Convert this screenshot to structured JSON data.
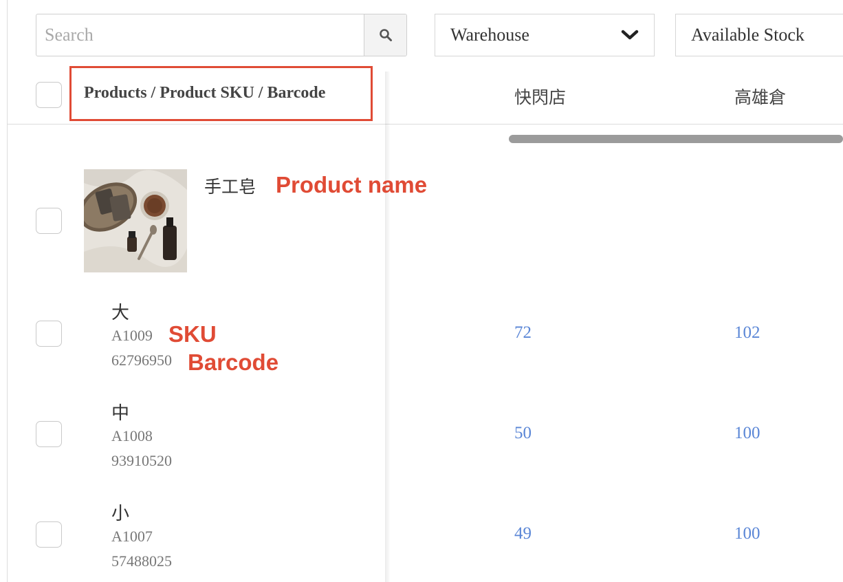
{
  "toolbar": {
    "search_placeholder": "Search",
    "warehouse_label": "Warehouse",
    "stock_label": "Available Stock"
  },
  "table": {
    "column_products": "Products / Product SKU / Barcode",
    "warehouses": [
      "快閃店",
      "高雄倉"
    ]
  },
  "product": {
    "name": "手工皂",
    "thumbnail_icon": "soap-photo"
  },
  "annotations": {
    "product_name": "Product name",
    "sku": "SKU",
    "barcode": "Barcode"
  },
  "variants": [
    {
      "name": "大",
      "sku": "A1009",
      "barcode": "62796950",
      "stock": [
        "72",
        "102"
      ]
    },
    {
      "name": "中",
      "sku": "A1008",
      "barcode": "93910520",
      "stock": [
        "50",
        "100"
      ]
    },
    {
      "name": "小",
      "sku": "A1007",
      "barcode": "57488025",
      "stock": [
        "49",
        "100"
      ]
    }
  ],
  "colors": {
    "annotation": "#e04b35",
    "link": "#5a86d6",
    "border": "#cfcfcf"
  }
}
